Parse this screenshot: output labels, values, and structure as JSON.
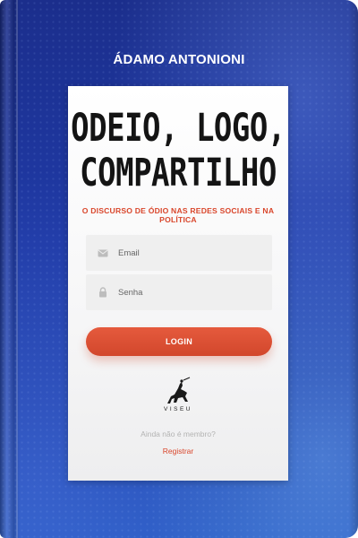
{
  "cover": {
    "author": "ÁDAMO ANTONIONI",
    "title_line1": "ODEIO, LOGO,",
    "title_line2": "COMPARTILHO",
    "subtitle": "O DISCURSO DE ÓDIO NAS REDES SOCIAIS E NA POLÍTICA",
    "publisher": "VISEU",
    "colors": {
      "background": "#1f3aa6",
      "accent": "#d9462b",
      "card": "#ffffff"
    }
  },
  "login_form": {
    "email_placeholder": "Email",
    "password_placeholder": "Senha",
    "login_label": "LOGIN",
    "member_prompt": "Ainda não é membro?",
    "register_label": "Registrar",
    "icons": {
      "email": "envelope-icon",
      "password": "lock-icon"
    }
  }
}
